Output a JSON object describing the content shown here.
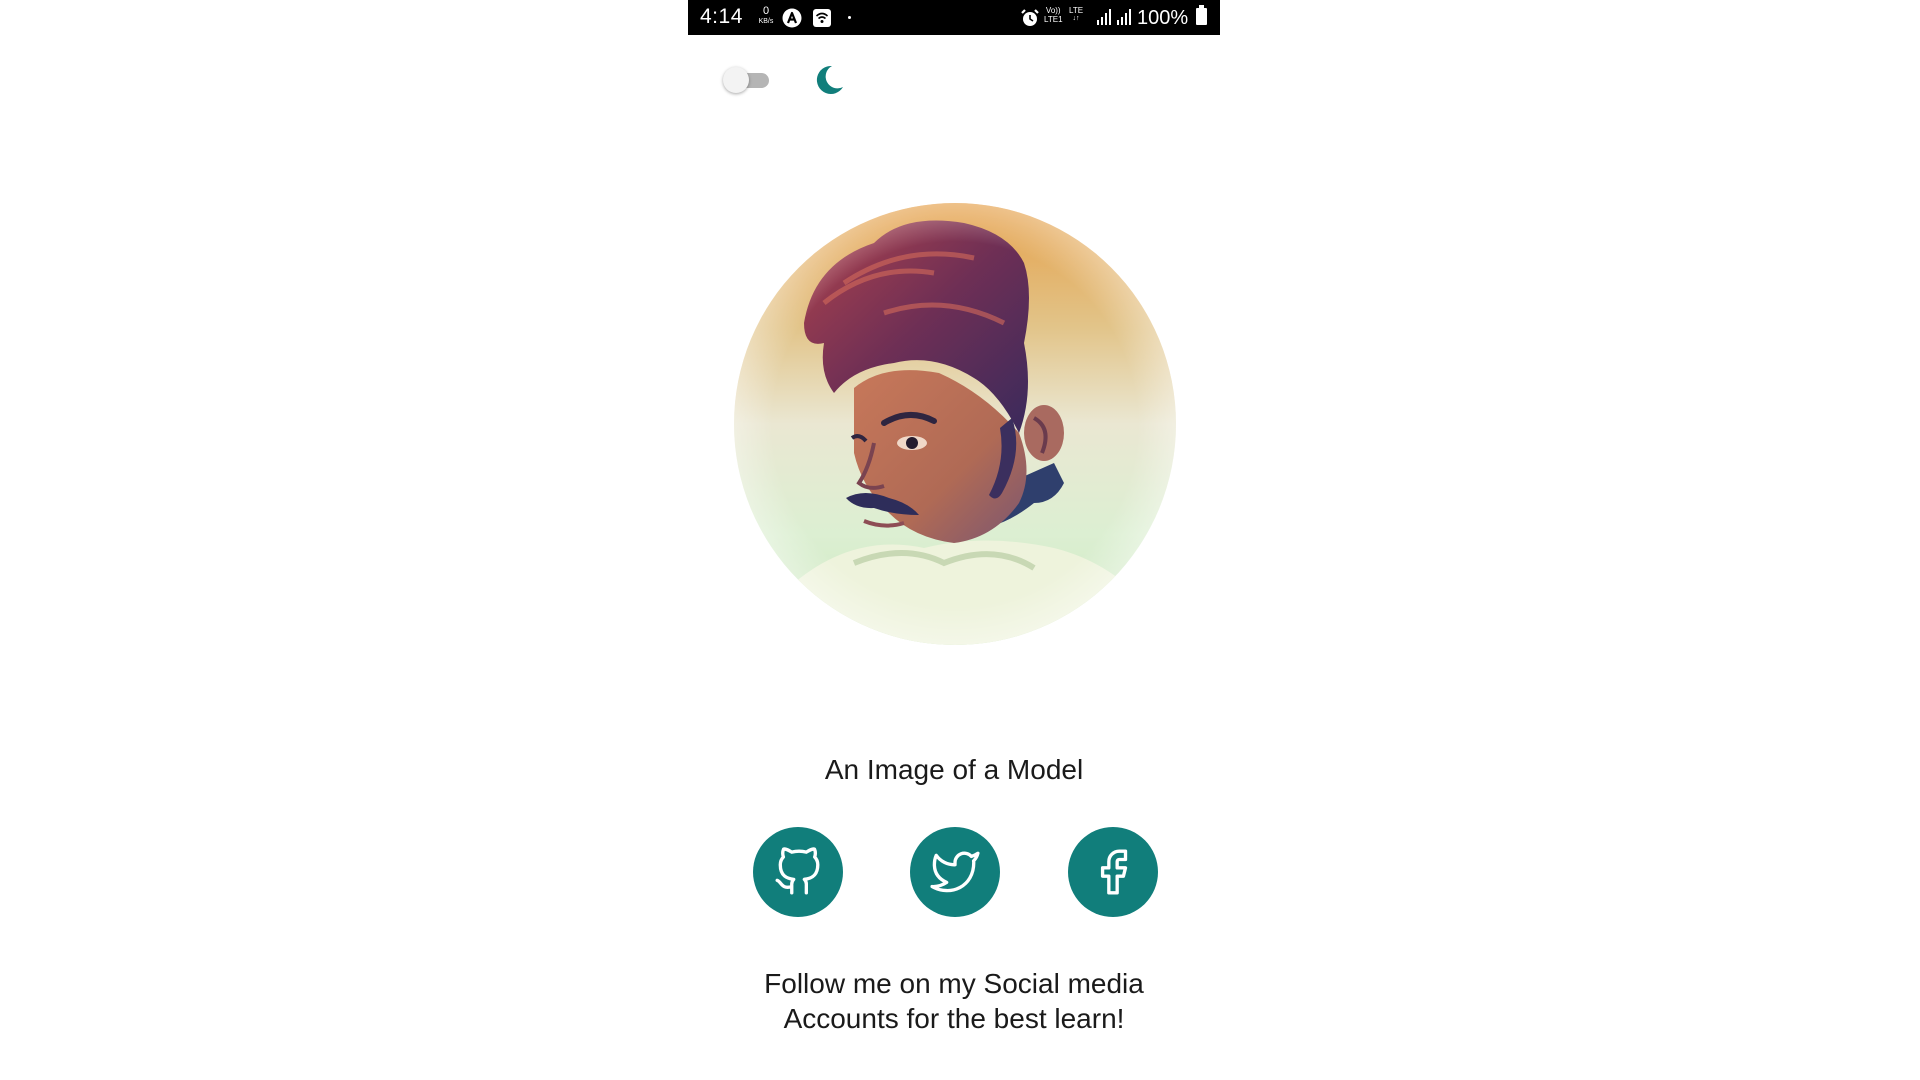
{
  "status_bar": {
    "time": "4:14",
    "net_speed_value": "0",
    "net_speed_unit": "KB/s",
    "volte_line1": "Vo))",
    "volte_line2": "LTE1",
    "lte_label": "LTE",
    "battery_percent": "100%"
  },
  "header": {
    "dark_mode_toggle_on": false,
    "moon_icon": "crescent-moon-icon"
  },
  "profile": {
    "avatar_icon": "profile-photo",
    "caption": "An Image of a Model"
  },
  "social": [
    {
      "name": "github",
      "icon": "github-icon"
    },
    {
      "name": "twitter",
      "icon": "twitter-icon"
    },
    {
      "name": "facebook",
      "icon": "facebook-icon"
    }
  ],
  "footer": {
    "line1": "Follow me on my Social media",
    "line2": "Accounts for the best learn!"
  },
  "colors": {
    "accent": "#117e7b",
    "status_bar_bg": "#000000",
    "background": "#ffffff",
    "text": "#1a1a1a"
  }
}
